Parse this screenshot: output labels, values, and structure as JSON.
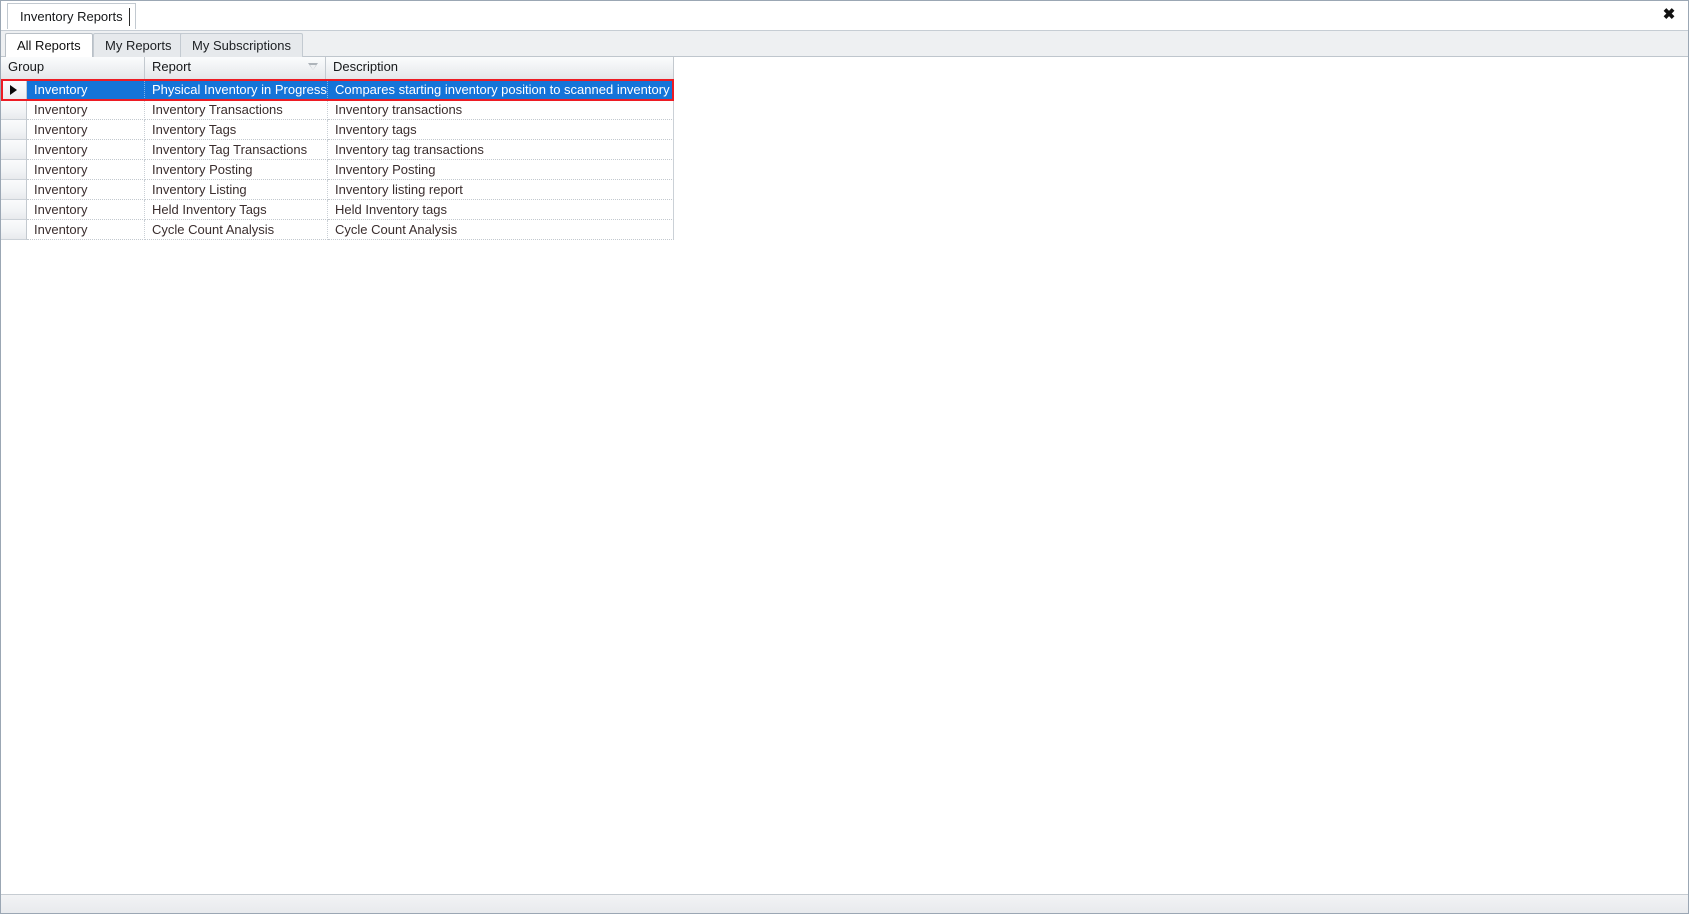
{
  "window": {
    "document_tab": "Inventory Reports",
    "close_label": "✖",
    "accent_selection_color": "#1574d8",
    "annotation_color": "#ed1c24"
  },
  "sub_tabs": [
    {
      "label": "All Reports",
      "selected": true
    },
    {
      "label": "My Reports",
      "selected": false
    },
    {
      "label": "My Subscriptions",
      "selected": false
    }
  ],
  "grid": {
    "columns": [
      {
        "key": "group",
        "header": "Group",
        "sorted": false
      },
      {
        "key": "report",
        "header": "Report",
        "sorted": true,
        "sort_direction": "descending"
      },
      {
        "key": "description",
        "header": "Description",
        "sorted": false
      }
    ],
    "rows": [
      {
        "group": "Inventory",
        "report": "Physical Inventory in Progress",
        "description": "Compares starting inventory position to scanned inventory",
        "selected": true
      },
      {
        "group": "Inventory",
        "report": "Inventory Transactions",
        "description": "Inventory transactions",
        "selected": false
      },
      {
        "group": "Inventory",
        "report": "Inventory Tags",
        "description": "Inventory tags",
        "selected": false
      },
      {
        "group": "Inventory",
        "report": "Inventory Tag Transactions",
        "description": "Inventory tag transactions",
        "selected": false
      },
      {
        "group": "Inventory",
        "report": "Inventory Posting",
        "description": "Inventory Posting",
        "selected": false
      },
      {
        "group": "Inventory",
        "report": "Inventory Listing",
        "description": "Inventory listing report",
        "selected": false
      },
      {
        "group": "Inventory",
        "report": "Held Inventory Tags",
        "description": "Held Inventory tags",
        "selected": false
      },
      {
        "group": "Inventory",
        "report": "Cycle Count Analysis",
        "description": "Cycle Count Analysis",
        "selected": false
      }
    ]
  },
  "statusbar": {
    "text": ""
  }
}
